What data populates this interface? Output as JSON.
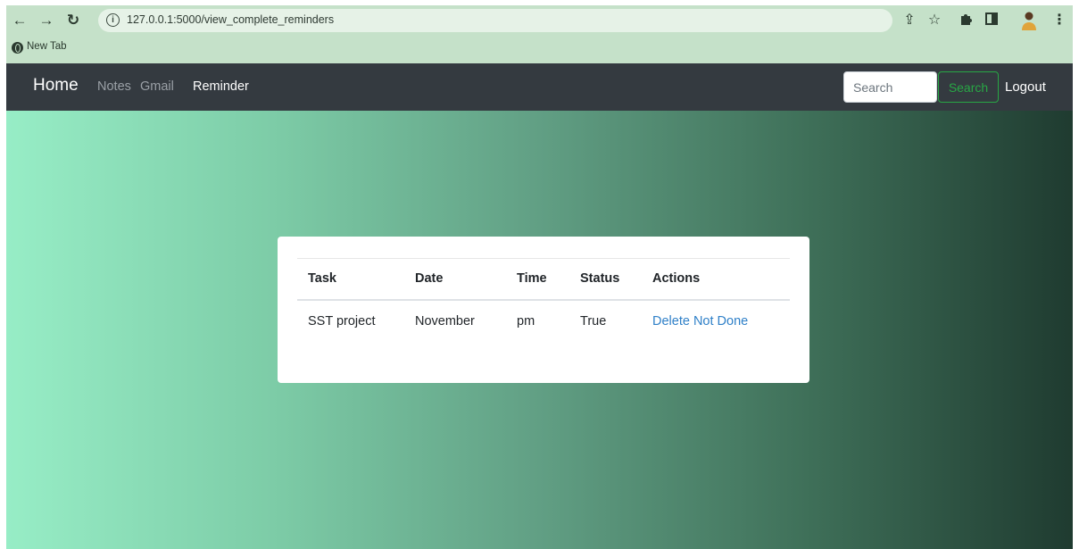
{
  "browser": {
    "url": "127.0.0.1:5000/view_complete_reminders",
    "bookmark": "New Tab",
    "icons": [
      "back-arrow-icon",
      "forward-arrow-icon",
      "reload-icon",
      "info-icon",
      "share-icon",
      "star-icon",
      "extensions-icon",
      "side-panel-icon",
      "profile-avatar",
      "menu-dots-icon"
    ]
  },
  "navbar": {
    "brand": "Home",
    "links": [
      "Notes",
      "Gmail",
      "Reminder"
    ],
    "active": "Reminder",
    "search_placeholder": "Search",
    "search_button": "Search",
    "logout": "Logout"
  },
  "table": {
    "headers": [
      "Task",
      "Date",
      "Time",
      "Status",
      "Actions"
    ],
    "rows": [
      {
        "task": "SST project",
        "date": "November",
        "time": "pm",
        "status": "True",
        "actions": [
          "Delete",
          "Not Done"
        ]
      }
    ]
  },
  "colors": {
    "navbar_bg": "#343a40",
    "chrome_bg": "#c5e1c9",
    "gradient_start": "#97edc6",
    "gradient_end": "#1f3b30",
    "link": "#2f80c8",
    "search_button": "#28a745"
  }
}
